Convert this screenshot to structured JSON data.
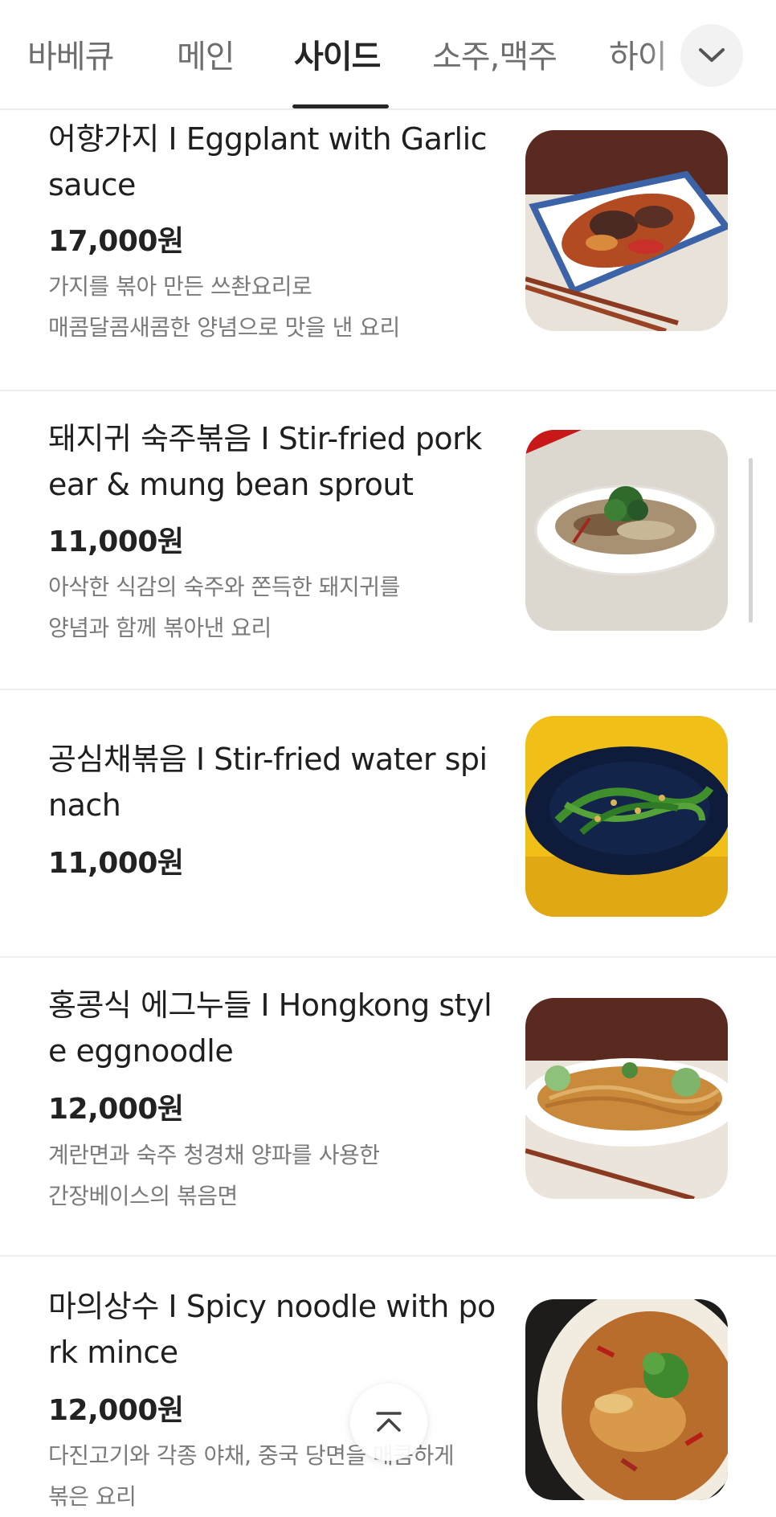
{
  "tabs": [
    {
      "label": "바베큐",
      "active": false
    },
    {
      "label": "메인",
      "active": false
    },
    {
      "label": "사이드",
      "active": true
    },
    {
      "label": "소주,맥주",
      "active": false
    },
    {
      "label": "하이",
      "active": false
    }
  ],
  "menu_items": [
    {
      "name": "어향가지 I Eggplant with Garlic sauce",
      "price": "17,000원",
      "desc_lines": [
        "가지를 볶아 만든 쓰촨요리로",
        "매콤달콤새콤한 양념으로 맛을 낸 요리"
      ]
    },
    {
      "name": "돼지귀 숙주볶음 I Stir-fried pork ear & mung bean sprout",
      "price": "11,000원",
      "desc_lines": [
        "아삭한 식감의 숙주와 쫀득한 돼지귀를",
        "양념과 함께 볶아낸 요리"
      ]
    },
    {
      "name": "공심채볶음 I Stir-fried water spinach",
      "price": "11,000원",
      "desc_lines": []
    },
    {
      "name": "홍콩식 에그누들 I Hongkong style eggnoodle",
      "price": "12,000원",
      "desc_lines": [
        "계란면과 숙주 청경채 양파를 사용한",
        "간장베이스의 볶음면"
      ]
    },
    {
      "name": "마의상수 I Spicy noodle with pork mince",
      "price": "12,000원",
      "desc_lines": [
        "다진고기와 각종 야채, 중국 당면을 매콤하게",
        "볶은 요리"
      ]
    }
  ],
  "icons": {
    "tab_more": "chevron-down-icon",
    "scroll_top": "chevron-up-icon"
  },
  "colors": {
    "active_tab": "#262626",
    "inactive_tab": "#6e6e6e",
    "divider": "#efefef"
  }
}
